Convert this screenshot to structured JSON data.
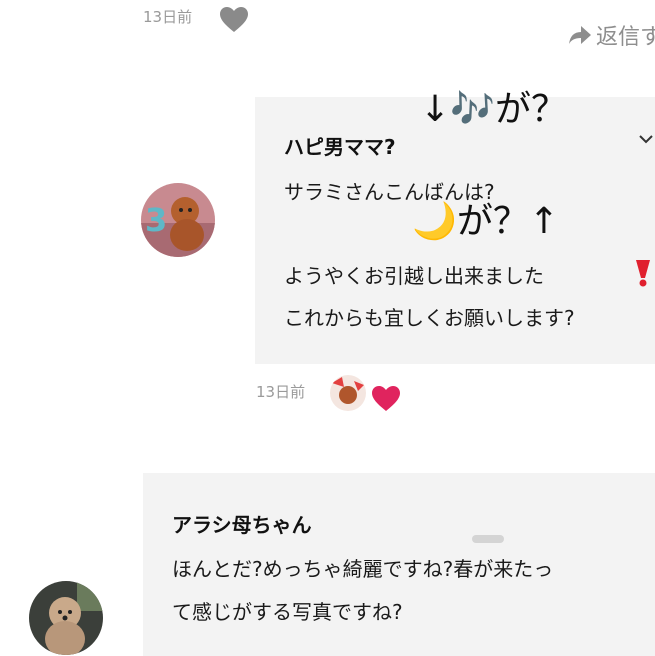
{
  "top_meta": {
    "time": "13日前",
    "reply_label": "返信す"
  },
  "comment1": {
    "author": "ハピ男ママ?",
    "lines": [
      "サラミさんこんばんは?",
      "ようやくお引越し出来ました",
      "これからも宜しくお願いします?"
    ],
    "time": "13日前"
  },
  "annotations": {
    "top": "↓🎶が？",
    "mid": "🌙が？↑"
  },
  "comment2": {
    "author": "アラシ母ちゃん",
    "lines": [
      "ほんとだ?めっちゃ綺麗ですね?春が来たっ",
      "て感じがする写真ですね?"
    ]
  },
  "icons": {
    "like_top": "heart-outline-gray-icon",
    "reply": "reply-arrow-icon",
    "exclaim": "red-exclamation-icon",
    "like_red": "heart-red-icon",
    "chevron": "chevron-down-icon"
  },
  "colors": {
    "bubble_bg": "#f3f3f3",
    "meta_gray": "#9a9a9a",
    "heart_red": "#e0245e"
  }
}
